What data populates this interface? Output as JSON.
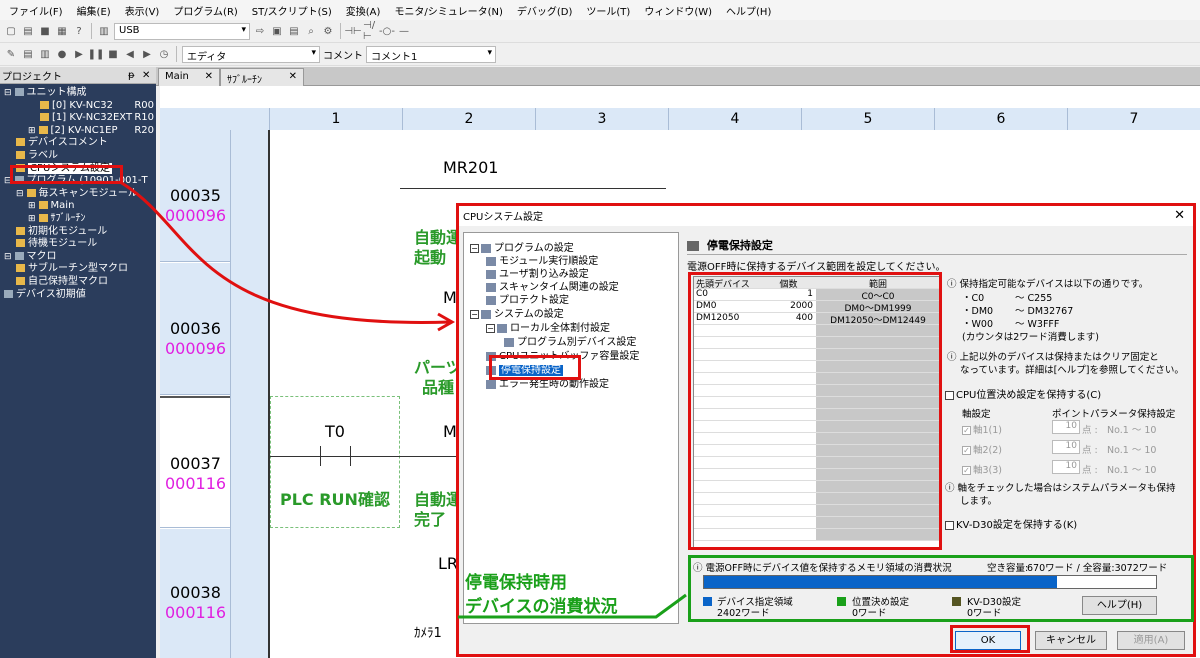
{
  "menu": [
    "ファイル(F)",
    "編集(E)",
    "表示(V)",
    "プログラム(R)",
    "ST/スクリプト(S)",
    "変換(A)",
    "モニタ/シミュレータ(N)",
    "デバッグ(D)",
    "ツール(T)",
    "ウィンドウ(W)",
    "ヘルプ(H)"
  ],
  "toolbar": {
    "connection": "USB",
    "editor": "エディタ",
    "comment_label": "コメント",
    "comment_value": "コメント1"
  },
  "project": {
    "title": "プロジェクト",
    "pin": "ᵽ",
    "close": "✕",
    "items": [
      {
        "label": "ユニット構成",
        "indent": 0,
        "exp": "⊟"
      },
      {
        "label": "[0]  KV-NC32",
        "extra": "R00",
        "indent": 3
      },
      {
        "label": "[1]  KV-NC32EXT",
        "extra": "R10",
        "indent": 3
      },
      {
        "label": "[2]  KV-NC1EP",
        "extra": "R20",
        "indent": 2,
        "exp": "⊞"
      },
      {
        "label": "デバイスコメント",
        "indent": 1
      },
      {
        "label": "ラベル",
        "indent": 1
      },
      {
        "label": "CPUシステム設定",
        "indent": 1
      },
      {
        "label": "プログラム (10901-001-T",
        "indent": 0,
        "exp": "⊟"
      },
      {
        "label": "毎スキャンモジュール",
        "indent": 1,
        "exp": "⊟"
      },
      {
        "label": "Main",
        "indent": 2,
        "exp": "⊞"
      },
      {
        "label": "ｻﾌﾞﾙｰﾁﾝ",
        "indent": 2,
        "exp": "⊞"
      },
      {
        "label": "初期化モジュール",
        "indent": 1
      },
      {
        "label": "待機モジュール",
        "indent": 1
      },
      {
        "label": "マクロ",
        "indent": 0,
        "exp": "⊟"
      },
      {
        "label": "サブルーチン型マクロ",
        "indent": 1
      },
      {
        "label": "自己保持型マクロ",
        "indent": 1
      },
      {
        "label": "デバイス初期値",
        "indent": 0
      }
    ]
  },
  "tabs": [
    {
      "label": "Main",
      "close": "✕"
    },
    {
      "label": "ｻﾌﾞﾙｰﾁﾝ",
      "close": "✕"
    }
  ],
  "ladder": {
    "columns": [
      "1",
      "2",
      "3",
      "4",
      "5",
      "6",
      "7"
    ],
    "rows": [
      {
        "line": "00035",
        "step": "000096"
      },
      {
        "line": "00036",
        "step": "000096"
      },
      {
        "line": "00037",
        "step": "000116"
      },
      {
        "line": "00038",
        "step": "000116"
      }
    ],
    "mr201": "MR201",
    "jidou1": "自動運",
    "kidou": "起動",
    "m1": "M",
    "parts": "パーツフ",
    "hinshu": "品種",
    "t0": "T0",
    "m2": "M",
    "plc": "PLC RUN確認",
    "jidou2": "自動運",
    "kanryo": "完了",
    "lr": "LR",
    "camera": "ｶﾒﾗ1"
  },
  "dialog": {
    "title": "CPUシステム設定",
    "close": "✕",
    "tree": [
      "プログラムの設定",
      "モジュール実行順設定",
      "ユーザ割り込み設定",
      "スキャンタイム関連の設定",
      "プロテクト設定",
      "システムの設定",
      "ローカル全体割付設定",
      "プログラム別デバイス設定",
      "CPUユニットバッファ容量設定",
      "停電保持設定",
      "エラー発生時の動作設定"
    ],
    "heading": "停電保持設定",
    "desc": "電源OFF時に保持するデバイス範囲を設定してください。",
    "table_headers": [
      "先頭デバイス",
      "個数",
      "範囲"
    ],
    "table_rows": [
      [
        "C0",
        "1",
        "C0～C0"
      ],
      [
        "DM0",
        "2000",
        "DM0～DM1999"
      ],
      [
        "DM12050",
        "400",
        "DM12050～DM12449"
      ]
    ],
    "info1": "保持指定可能なデバイスは以下の通りです。",
    "info_c": "・C0",
    "info_c_r": "～ C255",
    "info_dm": "・DM0",
    "info_dm_r": "～ DM32767",
    "info_w": "・W00",
    "info_w_r": "～ W3FFF",
    "info_count": "(カウンタは2ワード消費します)",
    "info2a": "上記以外のデバイスは保持またはクリア固定と",
    "info2b": "なっています。詳細は[ヘルプ]を参照してください。",
    "cpu_pos": "CPU位置決め設定を保持する(C)",
    "axis_hdr": "軸設定",
    "param_hdr": "ポイントパラメータ保持設定",
    "axes": [
      {
        "label": "軸1(1)",
        "val": "10",
        "unit": "点 :",
        "range": "No.1 ～ 10"
      },
      {
        "label": "軸2(2)",
        "val": "10",
        "unit": "点 :",
        "range": "No.1 ～ 10"
      },
      {
        "label": "軸3(3)",
        "val": "10",
        "unit": "点 :",
        "range": "No.1 ～ 10"
      }
    ],
    "axis_note_a": "軸をチェックした場合はシステムパラメータも保持",
    "axis_note_b": "します。",
    "kvd30": "KV-D30設定を保持する(K)",
    "mem_desc": "電源OFF時にデバイス値を保持するメモリ領域の消費状況",
    "free_label": "空き容量:",
    "free_val": "670ワード / 全容量:3072ワード",
    "usage_fraction": 0.78,
    "leg1": "デバイス指定領域",
    "leg1v": "2402ワード",
    "leg2": "位置決め設定",
    "leg2v": "0ワード",
    "leg3": "KV-D30設定",
    "leg3v": "0ワード",
    "help": "ヘルプ(H)",
    "ok": "OK",
    "cancel": "キャンセル",
    "apply": "適用(A)"
  },
  "annotation": {
    "line1": "停電保持時用",
    "line2": "デバイスの消費状況"
  },
  "colors": {
    "red": "#e01010",
    "green": "#1aa01a",
    "blue": "#0a64c8",
    "nav": "#2b3d5c",
    "step": "#e020e0"
  }
}
